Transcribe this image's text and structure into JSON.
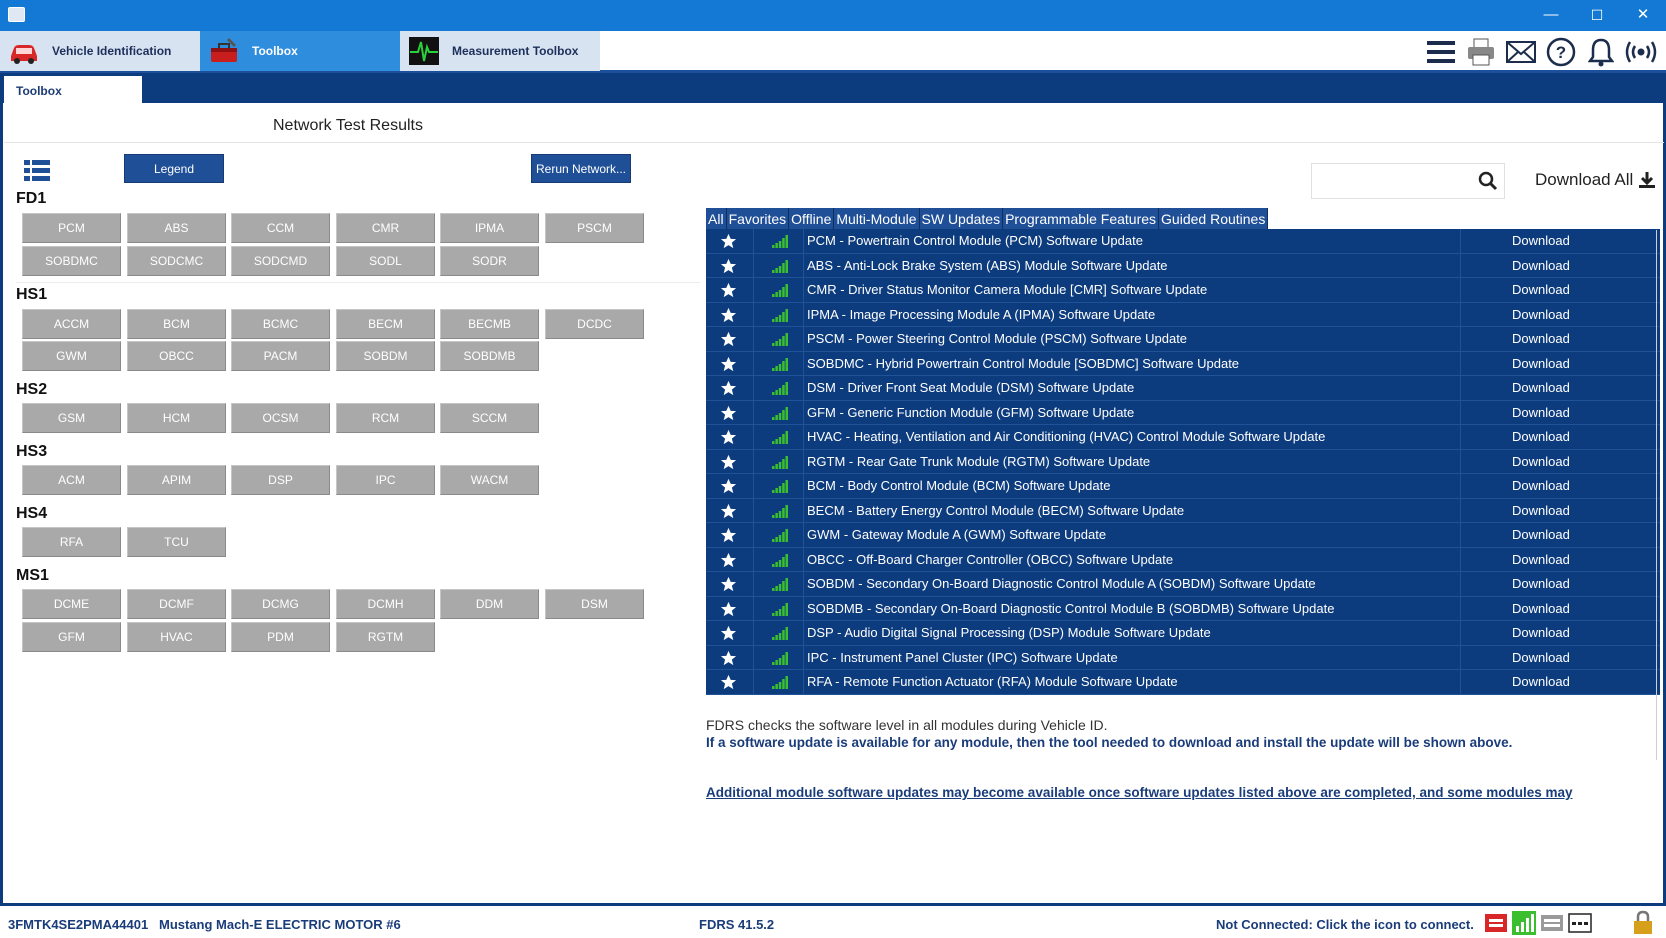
{
  "window": {
    "minimize_glyph": "—",
    "maximize_glyph": "☐",
    "close_glyph": "✕"
  },
  "top_tabs": [
    {
      "label": "Vehicle Identification",
      "icon": "car-icon"
    },
    {
      "label": "Toolbox",
      "icon": "toolbox-icon"
    },
    {
      "label": "Measurement Toolbox",
      "icon": "oscilloscope-icon"
    }
  ],
  "top_icons": [
    "menu-icon",
    "printer-icon",
    "mail-icon",
    "help-icon",
    "bell-icon",
    "connection-icon"
  ],
  "sub_tab": "Toolbox",
  "section_title": "Network Test Results",
  "legend_button": "Legend",
  "rerun_button": "Rerun Network...",
  "search": {
    "placeholder": ""
  },
  "download_all": "Download All",
  "networks": [
    {
      "name": "FD1",
      "modules": [
        "PCM",
        "ABS",
        "CCM",
        "CMR",
        "IPMA",
        "PSCM",
        "SOBDMC",
        "SODCMC",
        "SODCMD",
        "SODL",
        "SODR"
      ]
    },
    {
      "name": "HS1",
      "modules": [
        "ACCM",
        "BCM",
        "BCMC",
        "BECM",
        "BECMB",
        "DCDC",
        "GWM",
        "OBCC",
        "PACM",
        "SOBDM",
        "SOBDMB"
      ]
    },
    {
      "name": "HS2",
      "modules": [
        "GSM",
        "HCM",
        "OCSM",
        "RCM",
        "SCCM"
      ]
    },
    {
      "name": "HS3",
      "modules": [
        "ACM",
        "APIM",
        "DSP",
        "IPC",
        "WACM"
      ]
    },
    {
      "name": "HS4",
      "modules": [
        "RFA",
        "TCU"
      ]
    },
    {
      "name": "MS1",
      "modules": [
        "DCME",
        "DCMF",
        "DCMG",
        "DCMH",
        "DDM",
        "DSM",
        "GFM",
        "HVAC",
        "PDM",
        "RGTM"
      ]
    }
  ],
  "filters": [
    "All",
    "Favorites",
    "Offline",
    "Multi-Module",
    "SW Updates",
    "Programmable Features",
    "Guided Routines"
  ],
  "updates": [
    {
      "name": "PCM - Powertrain Control Module (PCM) Software Update",
      "action": "Download"
    },
    {
      "name": "ABS - Anti-Lock Brake System (ABS) Module Software Update",
      "action": "Download"
    },
    {
      "name": "CMR - Driver Status Monitor Camera Module [CMR] Software Update",
      "action": "Download"
    },
    {
      "name": "IPMA - Image Processing Module A (IPMA) Software Update",
      "action": "Download"
    },
    {
      "name": "PSCM - Power Steering Control Module (PSCM) Software Update",
      "action": "Download"
    },
    {
      "name": "SOBDMC - Hybrid Powertrain Control Module [SOBDMC] Software Update",
      "action": "Download"
    },
    {
      "name": "DSM - Driver Front Seat Module (DSM) Software Update",
      "action": "Download"
    },
    {
      "name": "GFM - Generic Function Module (GFM) Software Update",
      "action": "Download"
    },
    {
      "name": "HVAC - Heating, Ventilation and Air Conditioning (HVAC) Control Module Software Update",
      "action": "Download"
    },
    {
      "name": "RGTM - Rear Gate Trunk Module (RGTM) Software Update",
      "action": "Download"
    },
    {
      "name": "BCM - Body Control Module (BCM) Software Update",
      "action": "Download"
    },
    {
      "name": "BECM - Battery Energy Control Module (BECM) Software Update",
      "action": "Download"
    },
    {
      "name": "GWM - Gateway Module A (GWM) Software Update",
      "action": "Download"
    },
    {
      "name": "OBCC - Off-Board Charger Controller (OBCC) Software Update",
      "action": "Download"
    },
    {
      "name": "SOBDM - Secondary On-Board Diagnostic Control Module A (SOBDM) Software Update",
      "action": "Download"
    },
    {
      "name": "SOBDMB - Secondary On-Board Diagnostic Control Module B (SOBDMB) Software Update",
      "action": "Download"
    },
    {
      "name": "DSP - Audio Digital Signal Processing (DSP) Module Software Update",
      "action": "Download"
    },
    {
      "name": "IPC - Instrument Panel Cluster (IPC) Software Update",
      "action": "Download"
    },
    {
      "name": "RFA - Remote Function Actuator (RFA) Module Software Update",
      "action": "Download"
    }
  ],
  "info": {
    "line1": "FDRS checks the software level in all modules during Vehicle ID.",
    "line2": "If a software update is available for any module, then the tool needed to download and install the update will be shown above.",
    "line3": "Additional module software updates may become available once software updates listed above are completed, and some modules may"
  },
  "status": {
    "vin": "3FMTK4SE2PMA44401",
    "vehicle": "Mustang Mach-E ELECTRIC MOTOR #6",
    "version": "FDRS 41.5.2",
    "connection": "Not Connected: Click the icon to connect."
  },
  "colors": {
    "header_blue": "#1479d4",
    "navy": "#0d3c7e",
    "button_blue": "#1f4f97",
    "module_gray": "#a9a9a9",
    "signal_green": "#3bbf2e"
  }
}
